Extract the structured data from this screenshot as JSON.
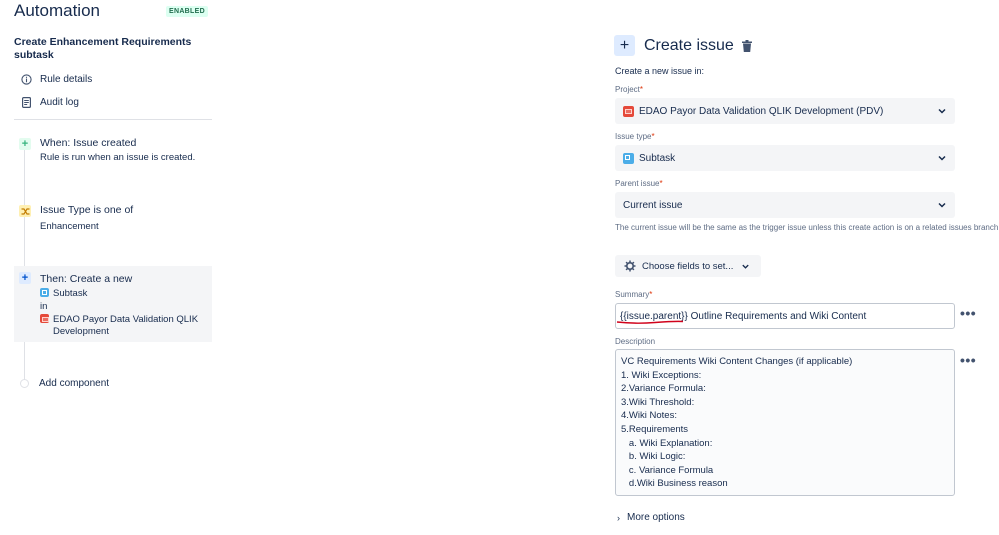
{
  "sidebar": {
    "app_title": "Automation",
    "status_badge": "ENABLED",
    "rule_name": "Create Enhancement Requirements subtask",
    "nav": [
      {
        "label": "Rule details",
        "icon": "info-icon"
      },
      {
        "label": "Audit log",
        "icon": "document-icon"
      }
    ],
    "trigger": {
      "title": "When: Issue created",
      "description": "Rule is run when an issue is created.",
      "icon": "plus-icon"
    },
    "condition": {
      "title": "Issue Type is one of",
      "value": "Enhancement",
      "icon": "branch-icon"
    },
    "action": {
      "title": "Then: Create a new",
      "issue_type": "Subtask",
      "in_label": "in",
      "project_line1": "EDAO Payor Data Validation QLIK",
      "project_line2": "Development",
      "icon": "plus-icon"
    },
    "add_component": "Add component"
  },
  "panel": {
    "title": "Create issue",
    "intro": "Create a new issue in:",
    "project": {
      "label": "Project",
      "value": "EDAO Payor Data Validation QLIK Development (PDV)"
    },
    "issue_type": {
      "label": "Issue type",
      "value": "Subtask"
    },
    "parent_issue": {
      "label": "Parent issue",
      "value": "Current issue",
      "hint": "The current issue will be the same as the trigger issue unless this create action is on a related issues branch"
    },
    "choose_fields": "Choose fields to set...",
    "summary": {
      "label": "Summary",
      "value": "{{issue.parent}} Outline Requirements and Wiki Content"
    },
    "description": {
      "label": "Description",
      "value": "VC Requirements Wiki Content Changes (if applicable)\n1. Wiki Exceptions:\n2.Variance Formula:\n3.Wiki Threshold:\n4.Wiki Notes:\n5.Requirements\n   a. Wiki Explanation:\n   b. Wiki Logic:\n   c. Variance Formula\n   d.Wiki Business reason"
    },
    "more_options": "More options",
    "more_actions_glyph": "•••",
    "required_mark": "*"
  },
  "colors": {
    "accent": "#0052cc",
    "badge_bg": "#dcfff1",
    "badge_text": "#216e4e",
    "annotation_red": "#d0021b"
  }
}
